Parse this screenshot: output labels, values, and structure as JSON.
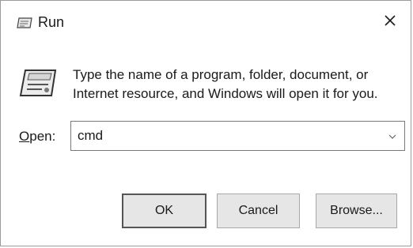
{
  "window": {
    "title": "Run",
    "close_glyph": "✕"
  },
  "icons": {
    "title_icon": "run-icon",
    "main_icon": "run-icon",
    "close_icon": "close-icon",
    "dropdown_icon": "chevron-down-icon"
  },
  "content": {
    "description": "Type the name of a program, folder, document, or Internet resource, and Windows will open it for you.",
    "open_label_accel": "O",
    "open_label_rest": "pen:",
    "input_value": "cmd"
  },
  "buttons": {
    "ok": "OK",
    "cancel": "Cancel",
    "browse": "Browse..."
  },
  "colors": {
    "background": "#ffffff",
    "button_face": "#e6e6e6",
    "default_button_border": "#555555",
    "text": "#1a1a1a"
  }
}
